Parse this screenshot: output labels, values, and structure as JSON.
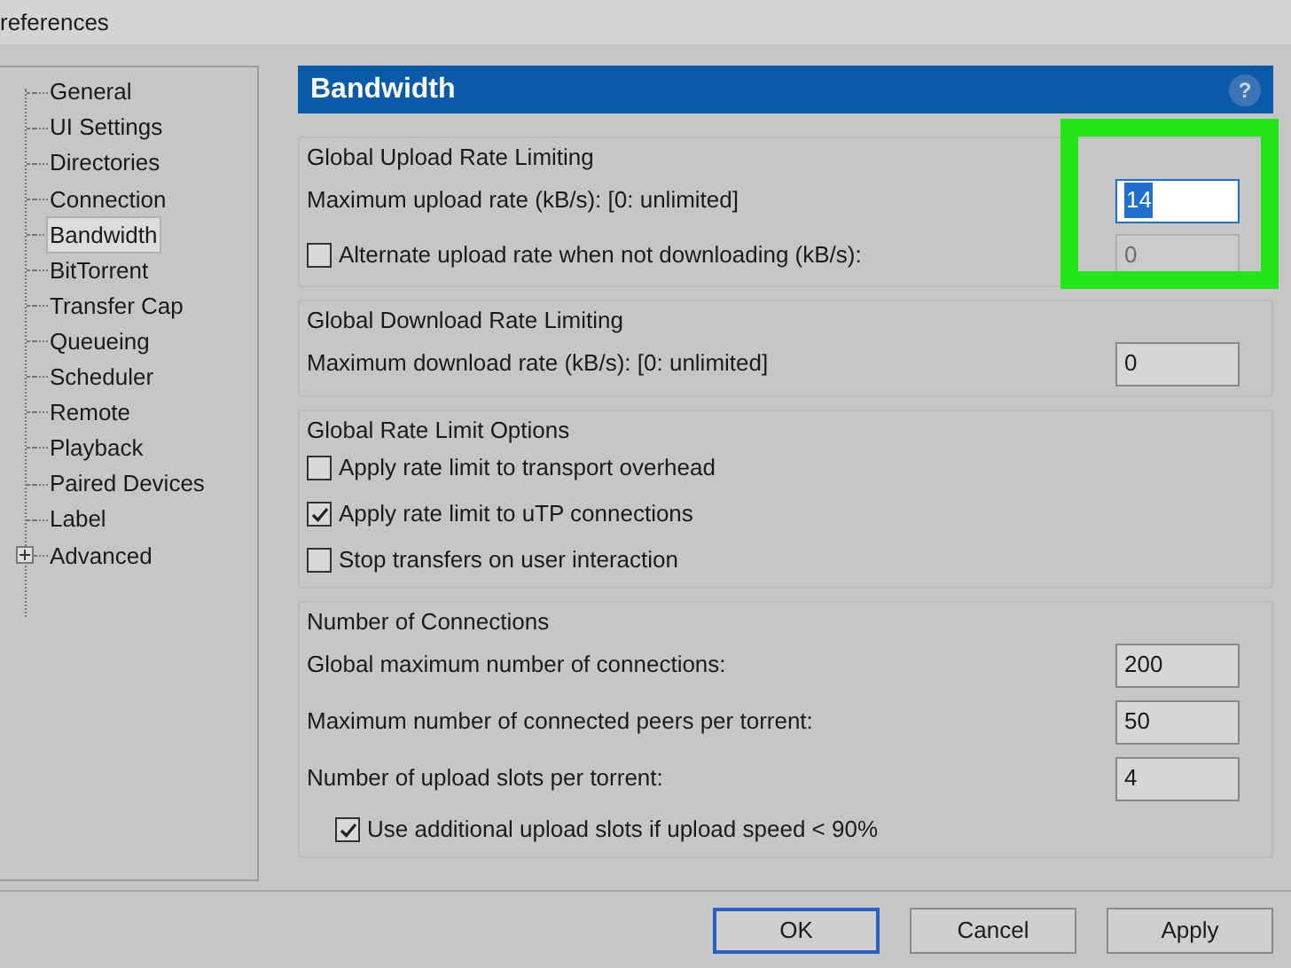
{
  "window": {
    "title": "references"
  },
  "tree": [
    {
      "label": "General",
      "selected": false
    },
    {
      "label": "UI Settings",
      "selected": false
    },
    {
      "label": "Directories",
      "selected": false
    },
    {
      "label": "Connection",
      "selected": false
    },
    {
      "label": "Bandwidth",
      "selected": true
    },
    {
      "label": "BitTorrent",
      "selected": false
    },
    {
      "label": "Transfer Cap",
      "selected": false
    },
    {
      "label": "Queueing",
      "selected": false
    },
    {
      "label": "Scheduler",
      "selected": false
    },
    {
      "label": "Remote",
      "selected": false
    },
    {
      "label": "Playback",
      "selected": false
    },
    {
      "label": "Paired Devices",
      "selected": false
    },
    {
      "label": "Label",
      "selected": false
    },
    {
      "label": "Advanced",
      "selected": false,
      "expanded": false
    }
  ],
  "panel": {
    "title": "Bandwidth",
    "help": "?"
  },
  "groups": [
    {
      "title": "Global Upload Rate Limiting",
      "rows": [
        {
          "kind": "field",
          "label": "Maximum upload rate (kB/s): [0: unlimited]",
          "value": "14",
          "selected": true,
          "disabled": false
        },
        {
          "kind": "checkbox_field",
          "label": "Alternate upload rate when not downloading (kB/s):",
          "checked": false,
          "value": "0",
          "selected": false,
          "disabled": true
        }
      ]
    },
    {
      "title": "Global Download Rate Limiting",
      "rows": [
        {
          "kind": "field",
          "label": "Maximum download rate (kB/s): [0: unlimited]",
          "value": "0",
          "selected": false,
          "disabled": false
        }
      ]
    },
    {
      "title": "Global Rate Limit Options",
      "rows": [
        {
          "kind": "checkbox",
          "label": "Apply rate limit to transport overhead",
          "checked": false
        },
        {
          "kind": "checkbox",
          "label": "Apply rate limit to uTP connections",
          "checked": true
        },
        {
          "kind": "checkbox",
          "label": "Stop transfers on user interaction",
          "checked": false
        }
      ]
    },
    {
      "title": "Number of Connections",
      "rows": [
        {
          "kind": "field",
          "label": "Global maximum number of connections:",
          "value": "200",
          "selected": false,
          "disabled": false
        },
        {
          "kind": "field",
          "label": "Maximum number of connected peers per torrent:",
          "value": "50",
          "selected": false,
          "disabled": false
        },
        {
          "kind": "field",
          "label": "Number of upload slots per torrent:",
          "value": "4",
          "selected": false,
          "disabled": false
        },
        {
          "kind": "sub_checkbox",
          "label": "Use additional upload slots if upload speed < 90%",
          "checked": true
        }
      ]
    }
  ],
  "buttons": [
    {
      "label": "OK",
      "default": true
    },
    {
      "label": "Cancel",
      "default": false
    },
    {
      "label": "Apply",
      "default": false
    }
  ],
  "highlight": {
    "on": true
  }
}
